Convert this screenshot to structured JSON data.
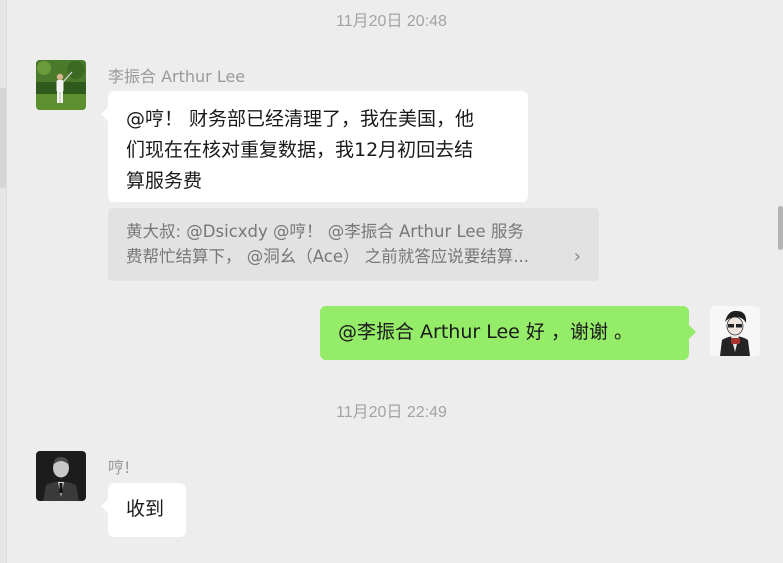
{
  "messages": [
    {
      "timestamp": "11月20日 20:48",
      "sender": "李振合 Arthur Lee",
      "text_lines": [
        "@哼！ 财务部已经清理了，我在美国，他",
        "们现在在核对重复数据，我12月初回去结",
        "算服务费"
      ],
      "quote": {
        "line1": "黄大叔: @Dsicxdy  @哼！  @李振合 Arthur Lee 服务",
        "line2": "费帮忙结算下，  @洞幺（Ace） 之前就答应说要结算...",
        "chevron": "›"
      }
    },
    {
      "self_text": "@李振合 Arthur Lee 好  ，谢谢 。"
    },
    {
      "timestamp": "11月20日 22:49",
      "sender": "哼!",
      "text": "收到"
    }
  ],
  "colors": {
    "background": "#ededed",
    "self_bubble": "#95ec69",
    "other_bubble": "#ffffff",
    "quote_bg": "#e2e2e2"
  }
}
